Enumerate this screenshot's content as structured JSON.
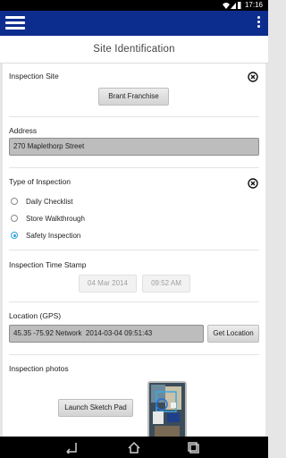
{
  "status_bar": {
    "time": "17:16",
    "icons": [
      "wifi-icon",
      "signal-icon",
      "battery-icon"
    ]
  },
  "app_bar": {
    "menu_icon": "hamburger-menu-icon",
    "overflow_icon": "overflow-menu-icon",
    "color": "#0d2d8e"
  },
  "title": "Site Identification",
  "inspection_site": {
    "label": "Inspection Site",
    "value": "Brant Franchise",
    "clear_icon": "clear-circle-icon"
  },
  "address": {
    "label": "Address",
    "value": "270 Maplethorp Street"
  },
  "inspection_type": {
    "label": "Type of Inspection",
    "clear_icon": "clear-circle-icon",
    "options": [
      {
        "label": "Daily Checklist",
        "selected": false
      },
      {
        "label": "Store Walkthrough",
        "selected": false
      },
      {
        "label": "Safety Inspection",
        "selected": true
      }
    ]
  },
  "time_stamp": {
    "label": "Inspection Time Stamp",
    "date": "04 Mar 2014",
    "time": "09:52 AM"
  },
  "location": {
    "label": "Location (GPS)",
    "value": "45.35 -75.92 Network  2014-03-04 09:51:43",
    "button": "Get Location"
  },
  "photos": {
    "label": "Inspection photos",
    "button": "Launch Sketch Pad"
  },
  "nav_bar": {
    "icons": [
      "back-icon",
      "home-icon",
      "recent-apps-icon"
    ]
  }
}
